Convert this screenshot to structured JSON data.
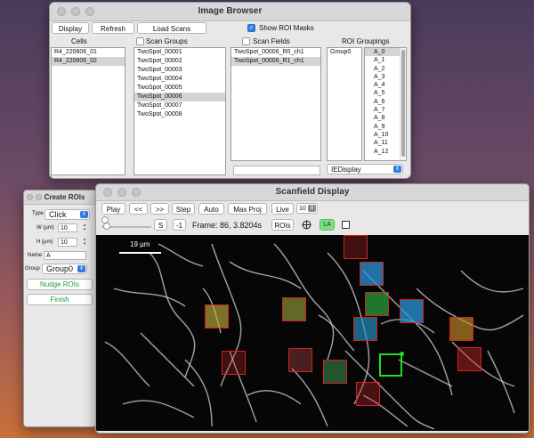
{
  "image_browser": {
    "title": "Image Browser",
    "display_label": "Display",
    "refresh_label": "Refresh",
    "load_scans_label": "Load Scans",
    "show_roi_masks_label": "Show ROI Masks",
    "show_roi_masks_checked": true,
    "cells_header": "Cells",
    "scan_groups_header": "Scan Groups",
    "scan_fields_header": "Scan Fields",
    "roi_groupings_header": "ROI Groupings",
    "cells": [
      {
        "label": "R4_220606_01",
        "selected": false
      },
      {
        "label": "R4_220606_02",
        "selected": true
      }
    ],
    "scan_groups": [
      {
        "label": "TwoSpot_00001",
        "selected": false
      },
      {
        "label": "TwoSpot_00002",
        "selected": false
      },
      {
        "label": "TwoSpot_00003",
        "selected": false
      },
      {
        "label": "TwoSpot_00004",
        "selected": false
      },
      {
        "label": "TwoSpot_00005",
        "selected": false
      },
      {
        "label": "TwoSpot_00006",
        "selected": true
      },
      {
        "label": "TwoSpot_00007",
        "selected": false
      },
      {
        "label": "TwoSpot_00008",
        "selected": false
      }
    ],
    "scan_fields": [
      {
        "label": "TwoSpot_00006_R0_ch1",
        "selected": false
      },
      {
        "label": "TwoSpot_00006_R1_ch1",
        "selected": true
      }
    ],
    "roi_group": "Group0",
    "roi_items": [
      "A_0",
      "A_1",
      "A_2",
      "A_3",
      "A_4",
      "A_5",
      "A_6",
      "A_7",
      "A_8",
      "A_9",
      "A_10",
      "A_11",
      "A_12"
    ],
    "roi_selected": "A_0",
    "display_mode": "IEDisplay"
  },
  "create_rois": {
    "title": "Create ROIs",
    "type_label": "Type",
    "type_value": "Click",
    "w_label": "W (µm)",
    "w_value": "10",
    "h_label": "H (µm)",
    "h_value": "10",
    "name_label": "Name",
    "name_value": "A",
    "group_label": "Group",
    "group_value": "Group0",
    "nudge_label": "Nudge ROIs",
    "finish_label": "Finish"
  },
  "scanfield": {
    "title": "Scanfield Display",
    "play_label": "Play",
    "prev_label": "<<",
    "next_label": ">>",
    "step_label": "Step",
    "auto_label": "Auto",
    "maxproj_label": "Max Proj",
    "live_label": "Live",
    "live_value": "10",
    "s_label": "S",
    "minus_one_label": "-1",
    "frame_text": "Frame: 86, 3.8204s",
    "rois_label": "ROIs",
    "la_label": "LA",
    "scalebar_label": "19 µm"
  },
  "colors": {
    "roi_red": "#d42020",
    "roi_green": "#22dd22",
    "accent_blue": "#2f7de1",
    "green_text": "#1a9e35"
  }
}
